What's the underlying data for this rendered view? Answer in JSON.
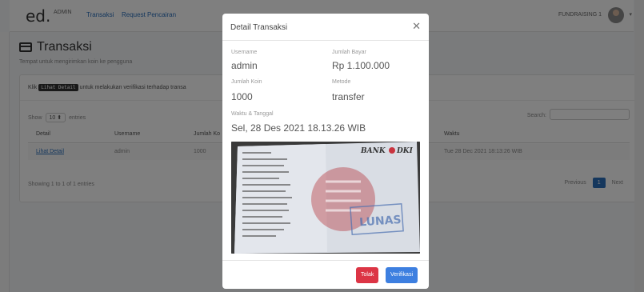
{
  "navbar": {
    "brand": "ed.",
    "brand_sub": "ADMIN",
    "links": [
      "Transaksi",
      "Request Pencairan"
    ],
    "user": "FUNDRAISING 1"
  },
  "page": {
    "title": "Transaksi",
    "subtitle": "Tempat untuk mengirimkan koin ke pengguna"
  },
  "card": {
    "klik_prefix": "Klik",
    "klik_code": "Lihat Detail",
    "klik_suffix": "untuk melakukan verifikasi terhadap transa",
    "show_label": "Show",
    "show_value": "10",
    "entries_label": "entries",
    "search_label": "Search:",
    "columns": [
      "Detail",
      "Username",
      "Jumlah Ko",
      "Waktu"
    ],
    "row": {
      "detail": "Lihat Detail",
      "username": "admin",
      "jumlah": "1000",
      "waktu": "Tue 28 Dec 2021 18:13:26 WIB"
    },
    "showing": "Showing 1 to 1 of 1 entries",
    "pager": {
      "prev": "Previous",
      "page": "1",
      "next": "Next"
    }
  },
  "modal": {
    "title": "Detail Transaksi",
    "username_label": "Username",
    "username": "admin",
    "jumlah_bayar_label": "Jumlah Bayar",
    "jumlah_bayar": "Rp 1.100.000",
    "jumlah_koin_label": "Jumlah Koin",
    "jumlah_koin": "1000",
    "metode_label": "Metode",
    "metode": "transfer",
    "waktu_label": "Waktu & Tanggal",
    "waktu": "Sel, 28 Des 2021 18.13.26 WIB",
    "receipt_bank": "BANK",
    "receipt_bank2": "DKI",
    "receipt_stamp": "LUNAS",
    "btn_tolak": "Tolak",
    "btn_verifikasi": "Verifikasi"
  },
  "colors": {
    "primary": "#3d7fe0",
    "danger": "#dc3545",
    "link": "#2a6ebb"
  }
}
